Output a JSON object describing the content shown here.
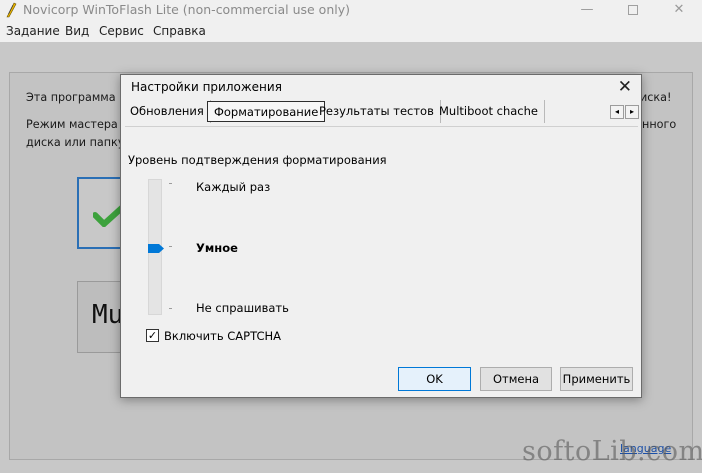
{
  "app": {
    "title": "Novicorp WinToFlash Lite (non-commercial use only)",
    "window_controls": {
      "minimize": "—",
      "close": "✕"
    }
  },
  "menu": {
    "items": [
      "Задание",
      "Вид",
      "Сервис",
      "Справка"
    ]
  },
  "background": {
    "line1_left": "Эта программа пом",
    "line1_right": "иска!",
    "line2_left": "Режим мастера про",
    "line2_right": "нного",
    "line3_left": "диска или папку, в",
    "multiboot_button_text": "Mu",
    "language_link": "language",
    "watermark": "softoLib.com"
  },
  "dialog": {
    "title": "Настройки приложения",
    "close_glyph": "✕",
    "tabs": [
      {
        "label": "Обновления",
        "active": false
      },
      {
        "label": "Форматирование",
        "active": true
      },
      {
        "label": "Результаты тестов",
        "active": false
      },
      {
        "label": "Multiboot chache",
        "active": false
      }
    ],
    "tab_scroll": {
      "left_glyph": "◂",
      "right_glyph": "▸"
    },
    "formatting": {
      "section_label": "Уровень подтверждения форматирования",
      "levels": [
        "Каждый раз",
        "Умное",
        "Не спрашивать"
      ],
      "selected_level": "Умное",
      "captcha_checkbox": {
        "label": "Включить CAPTCHA",
        "checked": true,
        "check_glyph": "✓"
      }
    },
    "buttons": {
      "ok": "OK",
      "cancel": "Отмена",
      "apply": "Применить"
    }
  },
  "colors": {
    "accent": "#0078d7",
    "wizard_check": "#3da23d",
    "selected_border": "#2a6fb5"
  },
  "icons": [
    "app-logo-icon",
    "checkmark-icon",
    "slider-thumb-icon",
    "chevron-left-icon",
    "chevron-right-icon",
    "close-icon"
  ]
}
